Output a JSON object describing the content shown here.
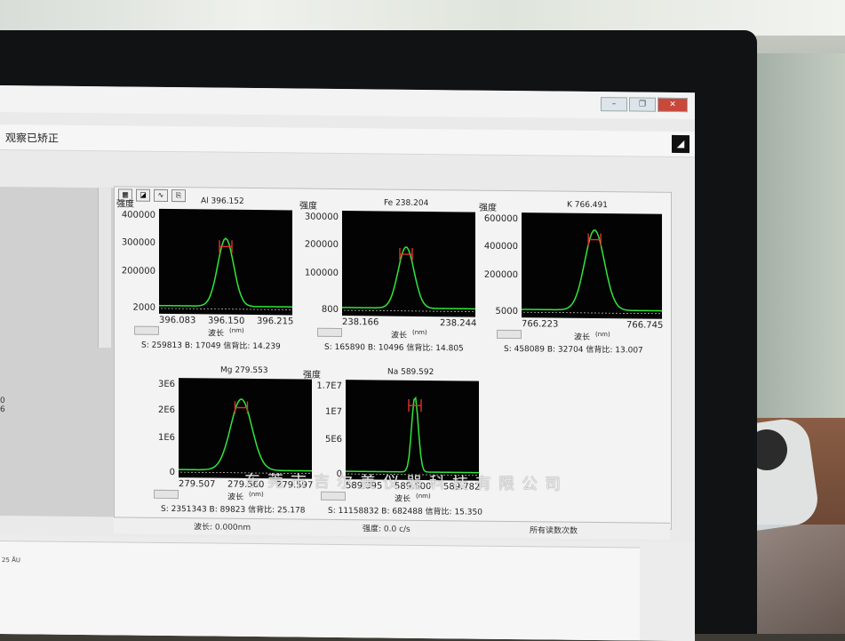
{
  "app": {
    "status_text": "观察已矫正",
    "window_buttons": [
      "–",
      "❐",
      "✕"
    ],
    "corner_button": "◢"
  },
  "watermark": "东莞市吉尔美仪器科技有限公司",
  "statusbar": {
    "wavelength": "波长: 0.000nm",
    "intensity": "强度: 0.0 c/s",
    "all_reps": "所有读数次数"
  },
  "left_panel": {
    "fragments": [
      "0",
      "6"
    ],
    "bottom_text": "25 ÅU"
  },
  "chart_data": [
    {
      "type": "line",
      "title": "Al 396.152",
      "ylabel": "强度",
      "xlabel": "波长",
      "xunit": "(nm)",
      "y_ticks": [
        "400000",
        "300000",
        "200000",
        "2000"
      ],
      "x_ticks": [
        "396.083",
        "396.150",
        "396.215"
      ],
      "stats": "S: 259813 B: 17049 信背比: 14.239",
      "peak_pos": 0.5,
      "peak_height": 0.72,
      "peak_width": 0.06,
      "series": [
        {
          "values": []
        }
      ]
    },
    {
      "type": "line",
      "title": "Fe 238.204",
      "ylabel": "强度",
      "xlabel": "波长",
      "xunit": "(nm)",
      "y_ticks": [
        "300000",
        "200000",
        "100000",
        "800"
      ],
      "x_ticks": [
        "238.166",
        "238.244"
      ],
      "stats": "S: 165890 B: 10496 信背比: 14.805",
      "peak_pos": 0.48,
      "peak_height": 0.65,
      "peak_width": 0.06,
      "series": [
        {
          "values": []
        }
      ]
    },
    {
      "type": "line",
      "title": "K 766.491",
      "ylabel": "强度",
      "xlabel": "波长",
      "xunit": "(nm)",
      "y_ticks": [
        "600000",
        "400000",
        "200000",
        "5000"
      ],
      "x_ticks": [
        "766.223",
        "766.745"
      ],
      "stats": "S: 458089 B: 32704 信背比: 13.007",
      "peak_pos": 0.52,
      "peak_height": 0.85,
      "peak_width": 0.07,
      "series": [
        {
          "values": []
        }
      ]
    },
    {
      "type": "line",
      "title": "Mg 279.553",
      "ylabel": "",
      "xlabel": "波长",
      "xunit": "(nm)",
      "y_ticks": [
        "3E6",
        "2E6",
        "1E6",
        "0"
      ],
      "x_ticks": [
        "279.507",
        "279.560",
        "279.597"
      ],
      "stats": "S: 2351343 B: 89823 信背比: 25.178",
      "peak_pos": 0.47,
      "peak_height": 0.8,
      "peak_width": 0.08,
      "series": [
        {
          "values": []
        }
      ]
    },
    {
      "type": "line",
      "title": "Na 589.592",
      "ylabel": "强度",
      "xlabel": "波长",
      "xunit": "(nm)",
      "y_ticks": [
        "1.7E7",
        "1E7",
        "5E6",
        "0"
      ],
      "x_ticks": [
        "589.395",
        "589.600",
        "589.782"
      ],
      "stats": "S: 11158832 B: 682488 信背比: 15.350",
      "peak_pos": 0.52,
      "peak_height": 0.85,
      "peak_width": 0.025,
      "series": [
        {
          "values": []
        }
      ]
    }
  ]
}
